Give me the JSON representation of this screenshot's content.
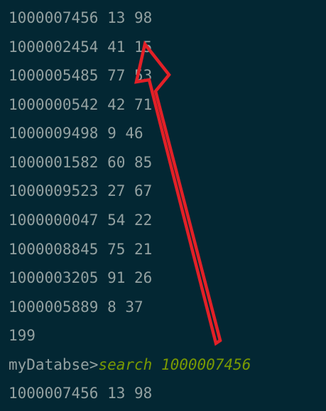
{
  "terminal": {
    "records": [
      "1000007456 13 98",
      "1000002454 41 15",
      "1000005485 77 53",
      "1000000542 42 71",
      "1000009498 9 46",
      "1000001582 60 85",
      "1000009523 27 67",
      "1000000047 54 22",
      "1000008845 75 21",
      "1000003205 91 26",
      "1000005889 8 37"
    ],
    "count": "199",
    "prompt": "myDatabse>",
    "command": "search 1000007456",
    "result": "1000007456 13 98"
  },
  "annotation": {
    "arrow_color": "#e32027"
  }
}
